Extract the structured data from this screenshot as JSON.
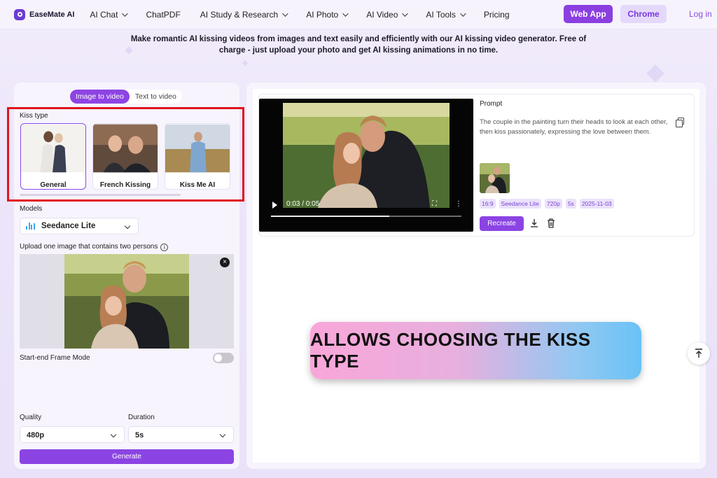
{
  "header": {
    "brand": "EaseMate AI",
    "nav": [
      {
        "label": "AI Chat",
        "dropdown": true
      },
      {
        "label": "ChatPDF",
        "dropdown": false
      },
      {
        "label": "AI Study & Research",
        "dropdown": true
      },
      {
        "label": "AI Photo",
        "dropdown": true
      },
      {
        "label": "AI Video",
        "dropdown": true
      },
      {
        "label": "AI Tools",
        "dropdown": true
      },
      {
        "label": "Pricing",
        "dropdown": false
      }
    ],
    "web_app": "Web App",
    "chrome": "Chrome",
    "login": "Log in",
    "accent": "#8b3fe0"
  },
  "intro": "Make romantic AI kissing videos from images and text easily and efficiently with our AI kissing video generator. Free of charge - just upload your photo and get AI kissing animations in no time.",
  "left": {
    "tabs": [
      "Image to video",
      "Text to video"
    ],
    "kiss_type_label": "Kiss type",
    "kiss_types": [
      "General",
      "French Kissing",
      "Kiss Me AI"
    ],
    "models_label": "Models",
    "model": "Seedance Lite",
    "upload_label": "Upload one image that contains two persons",
    "frame_mode_label": "Start-end Frame Mode",
    "quality_label": "Quality",
    "quality": "480p",
    "duration_label": "Duration",
    "duration": "5s",
    "generate": "Generate"
  },
  "result": {
    "video_time": "0:03 / 0:05",
    "prompt_label": "Prompt",
    "prompt": "The couple in the painting turn their heads to look at each other, then kiss passionately, expressing the love between them.",
    "tags": [
      "16:9",
      "Seedance Lite",
      "720p",
      "5s",
      "2025-11-03"
    ],
    "recreate": "Recreate"
  },
  "banner": "ALLOWS CHOOSING THE KISS TYPE"
}
